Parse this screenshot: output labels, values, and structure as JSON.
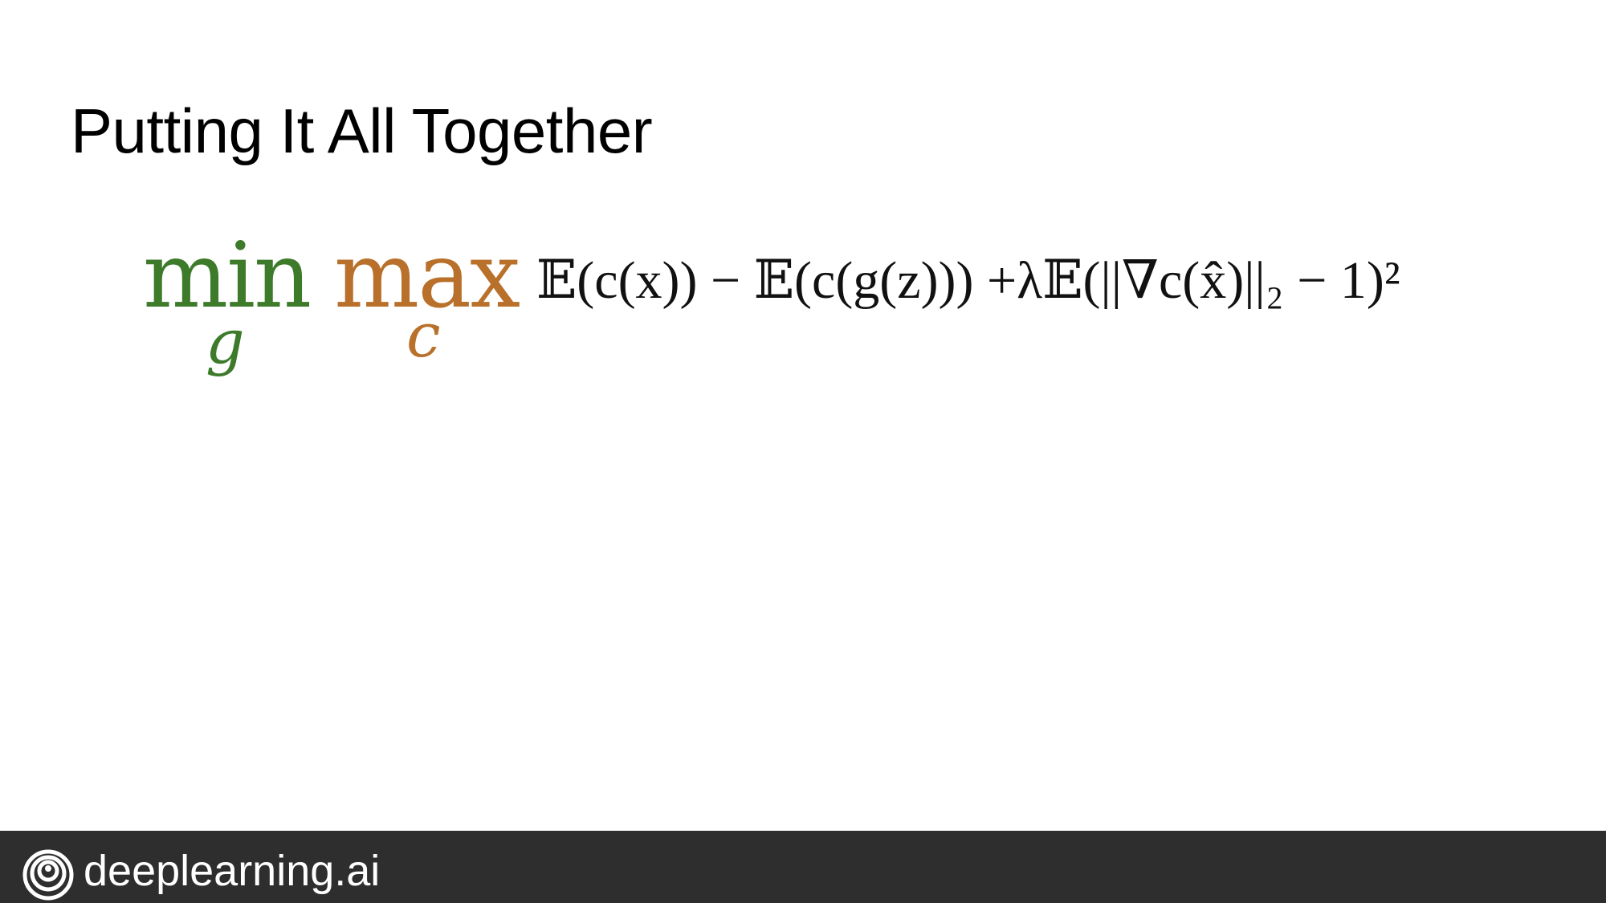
{
  "slide": {
    "title": "Putting It All Together"
  },
  "equation": {
    "min_operator": "min",
    "min_subscript": "g",
    "max_operator": "max",
    "max_subscript": "c",
    "expression": "𝔼(c(x)) − 𝔼(c(g(z))) +λ𝔼(||∇c(x̂)||₂ − 1)²",
    "colors": {
      "min": "#3d7a2a",
      "max": "#b8702a",
      "expression": "#111111"
    }
  },
  "footer": {
    "brand": "deeplearning.ai",
    "logo_icon": "deeplearning-logo-icon",
    "background": "#2e2e2e"
  }
}
